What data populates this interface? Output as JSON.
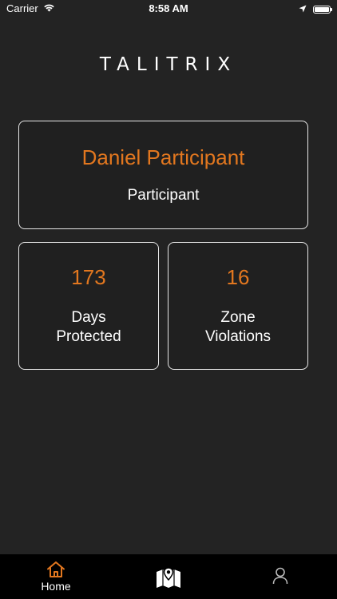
{
  "status_bar": {
    "carrier": "Carrier",
    "time": "8:58 AM"
  },
  "logo": {
    "text": "TALITRIX"
  },
  "profile": {
    "name": "Daniel Participant",
    "role": "Participant"
  },
  "stats": {
    "days_protected": {
      "value": "173",
      "label_line1": "Days",
      "label_line2": "Protected"
    },
    "zone_violations": {
      "value": "16",
      "label_line1": "Zone",
      "label_line2": "Violations"
    }
  },
  "tab_bar": {
    "home_label": "Home",
    "active_tab": "home",
    "icons": {
      "home": "home-icon",
      "map": "map-icon",
      "profile": "person-icon"
    }
  },
  "colors": {
    "accent": "#e2771f",
    "background": "#232323",
    "tab_bar_background": "#000000",
    "card_border": "#e6e6e6"
  }
}
